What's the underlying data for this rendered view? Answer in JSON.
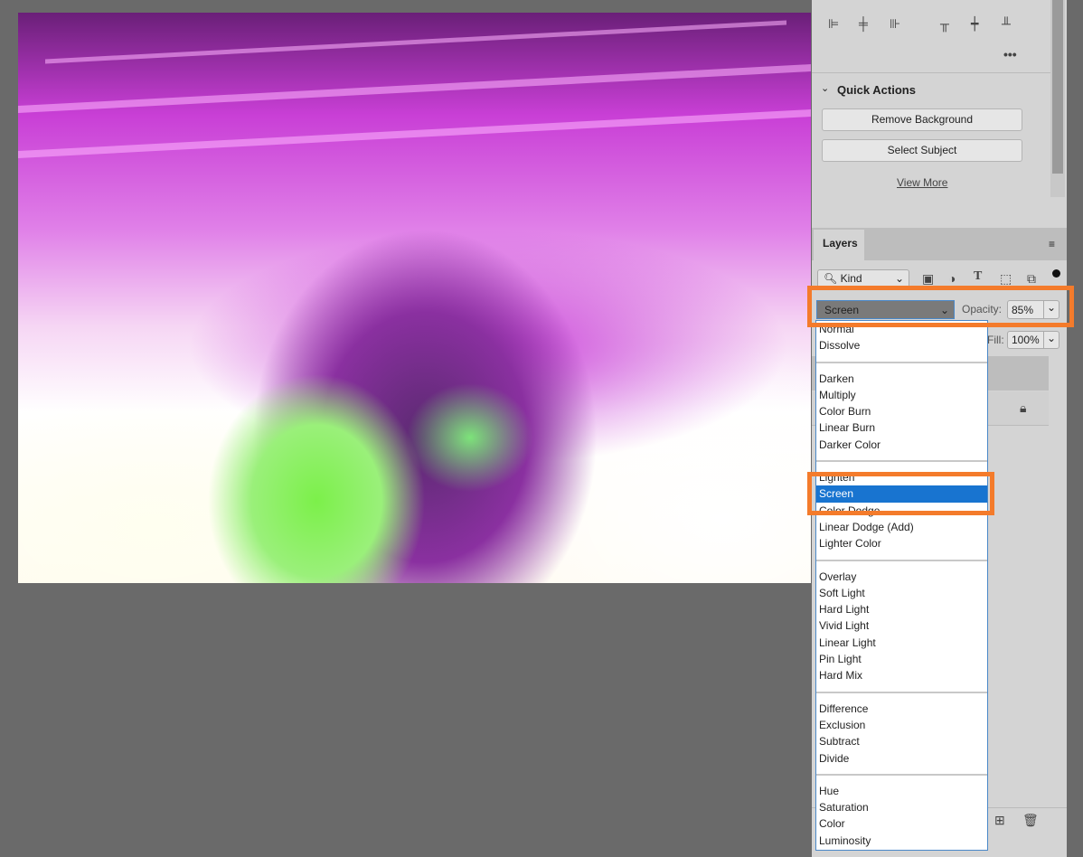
{
  "quick_actions": {
    "title": "Quick Actions",
    "remove_background": "Remove Background",
    "select_subject": "Select Subject",
    "view_more": "View More"
  },
  "layers": {
    "tab": "Layers",
    "filter_kind": "Kind",
    "blend_mode": "Screen",
    "opacity_label": "Opacity:",
    "opacity_value": "85%",
    "fill_label": "Fill:",
    "fill_value": "100%"
  },
  "blend_modes": [
    [
      "Normal",
      "Dissolve"
    ],
    [
      "Darken",
      "Multiply",
      "Color Burn",
      "Linear Burn",
      "Darker Color"
    ],
    [
      "Lighten",
      "Screen",
      "Color Dodge",
      "Linear Dodge (Add)",
      "Lighter Color"
    ],
    [
      "Overlay",
      "Soft Light",
      "Hard Light",
      "Vivid Light",
      "Linear Light",
      "Pin Light",
      "Hard Mix"
    ],
    [
      "Difference",
      "Exclusion",
      "Subtract",
      "Divide"
    ],
    [
      "Hue",
      "Saturation",
      "Color",
      "Luminosity"
    ]
  ],
  "selected_blend_mode": "Screen",
  "colors": {
    "highlight": "#f47b2b",
    "selection": "#1874d0"
  }
}
